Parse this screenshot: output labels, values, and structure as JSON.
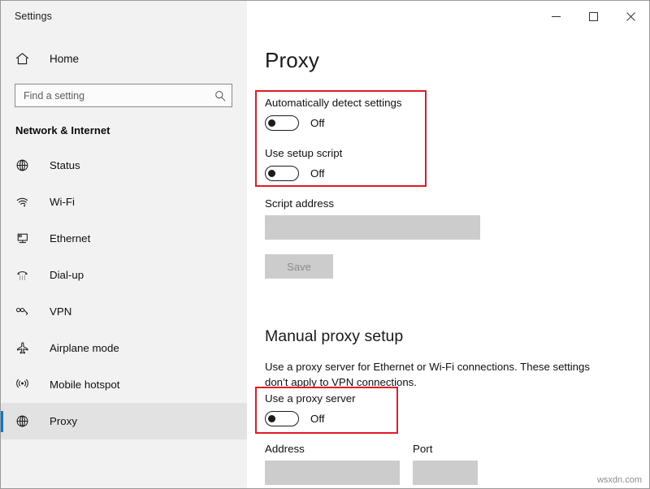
{
  "window": {
    "app_title": "Settings",
    "controls": [
      {
        "name": "minimize",
        "label": "—"
      },
      {
        "name": "maximize",
        "label": "□"
      },
      {
        "name": "close",
        "label": "✕"
      }
    ]
  },
  "sidebar": {
    "home": {
      "label": "Home",
      "icon": "home-icon"
    },
    "search": {
      "placeholder": "Find a setting",
      "value": "",
      "icon": "search-icon"
    },
    "section_heading": "Network & Internet",
    "items": [
      {
        "label": "Status",
        "icon": "globe-status-icon",
        "selected": false
      },
      {
        "label": "Wi-Fi",
        "icon": "wifi-icon",
        "selected": false
      },
      {
        "label": "Ethernet",
        "icon": "ethernet-icon",
        "selected": false
      },
      {
        "label": "Dial-up",
        "icon": "dialup-icon",
        "selected": false
      },
      {
        "label": "VPN",
        "icon": "vpn-icon",
        "selected": false
      },
      {
        "label": "Airplane mode",
        "icon": "airplane-icon",
        "selected": false
      },
      {
        "label": "Mobile hotspot",
        "icon": "hotspot-icon",
        "selected": false
      },
      {
        "label": "Proxy",
        "icon": "proxy-globe-icon",
        "selected": true
      }
    ]
  },
  "main": {
    "page_title": "Proxy",
    "auto_detect": {
      "label": "Automatically detect settings",
      "state": "Off"
    },
    "setup_script": {
      "label": "Use setup script",
      "state": "Off"
    },
    "script_address": {
      "label": "Script address",
      "value": ""
    },
    "save_label": "Save",
    "manual_heading": "Manual proxy setup",
    "manual_description": "Use a proxy server for Ethernet or Wi-Fi connections. These settings don’t apply to VPN connections.",
    "use_proxy": {
      "label": "Use a proxy server",
      "state": "Off"
    },
    "address": {
      "label": "Address",
      "value": ""
    },
    "port": {
      "label": "Port",
      "value": ""
    }
  },
  "annotations": {
    "accent_color": "#e01b24",
    "boxes": [
      {
        "name": "annotation-box-auto-script"
      },
      {
        "name": "annotation-box-use-proxy"
      }
    ]
  },
  "watermark": "wsxdn.com"
}
